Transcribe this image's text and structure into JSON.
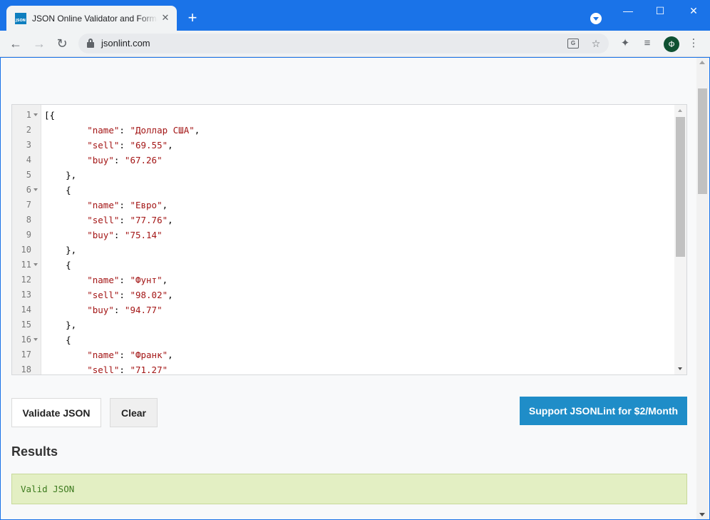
{
  "browser": {
    "tab_title": "JSON Online Validator and Formatter",
    "favicon_text": "JSON",
    "tab_close": "✕",
    "new_tab": "+",
    "url": "jsonlint.com",
    "avatar_letter": "Ф",
    "window": {
      "minimize": "—",
      "maximize": "☐",
      "close": "✕"
    }
  },
  "editor": {
    "lines": [
      {
        "n": "1",
        "fold": true
      },
      {
        "n": "2"
      },
      {
        "n": "3"
      },
      {
        "n": "4"
      },
      {
        "n": "5"
      },
      {
        "n": "6",
        "fold": true
      },
      {
        "n": "7"
      },
      {
        "n": "8"
      },
      {
        "n": "9"
      },
      {
        "n": "10"
      },
      {
        "n": "11",
        "fold": true
      },
      {
        "n": "12"
      },
      {
        "n": "13"
      },
      {
        "n": "14"
      },
      {
        "n": "15"
      },
      {
        "n": "16",
        "fold": true
      },
      {
        "n": "17"
      },
      {
        "n": "18"
      }
    ],
    "items": [
      {
        "name": "Доллар США",
        "sell": "69.55",
        "buy": "67.26"
      },
      {
        "name": "Евро",
        "sell": "77.76",
        "buy": "75.14"
      },
      {
        "name": "Фунт",
        "sell": "98.02",
        "buy": "94.77"
      },
      {
        "name": "Франк",
        "sell": "71.27"
      }
    ]
  },
  "buttons": {
    "validate": "Validate JSON",
    "clear": "Clear",
    "support": "Support JSONLint for $2/Month"
  },
  "results": {
    "title": "Results",
    "message": "Valid JSON"
  },
  "colors": {
    "chrome_blue": "#1a73e8",
    "support_button": "#1f8dc8",
    "result_bg": "#e3efc3",
    "result_text": "#3c7a1e",
    "json_string": "#a31515"
  }
}
